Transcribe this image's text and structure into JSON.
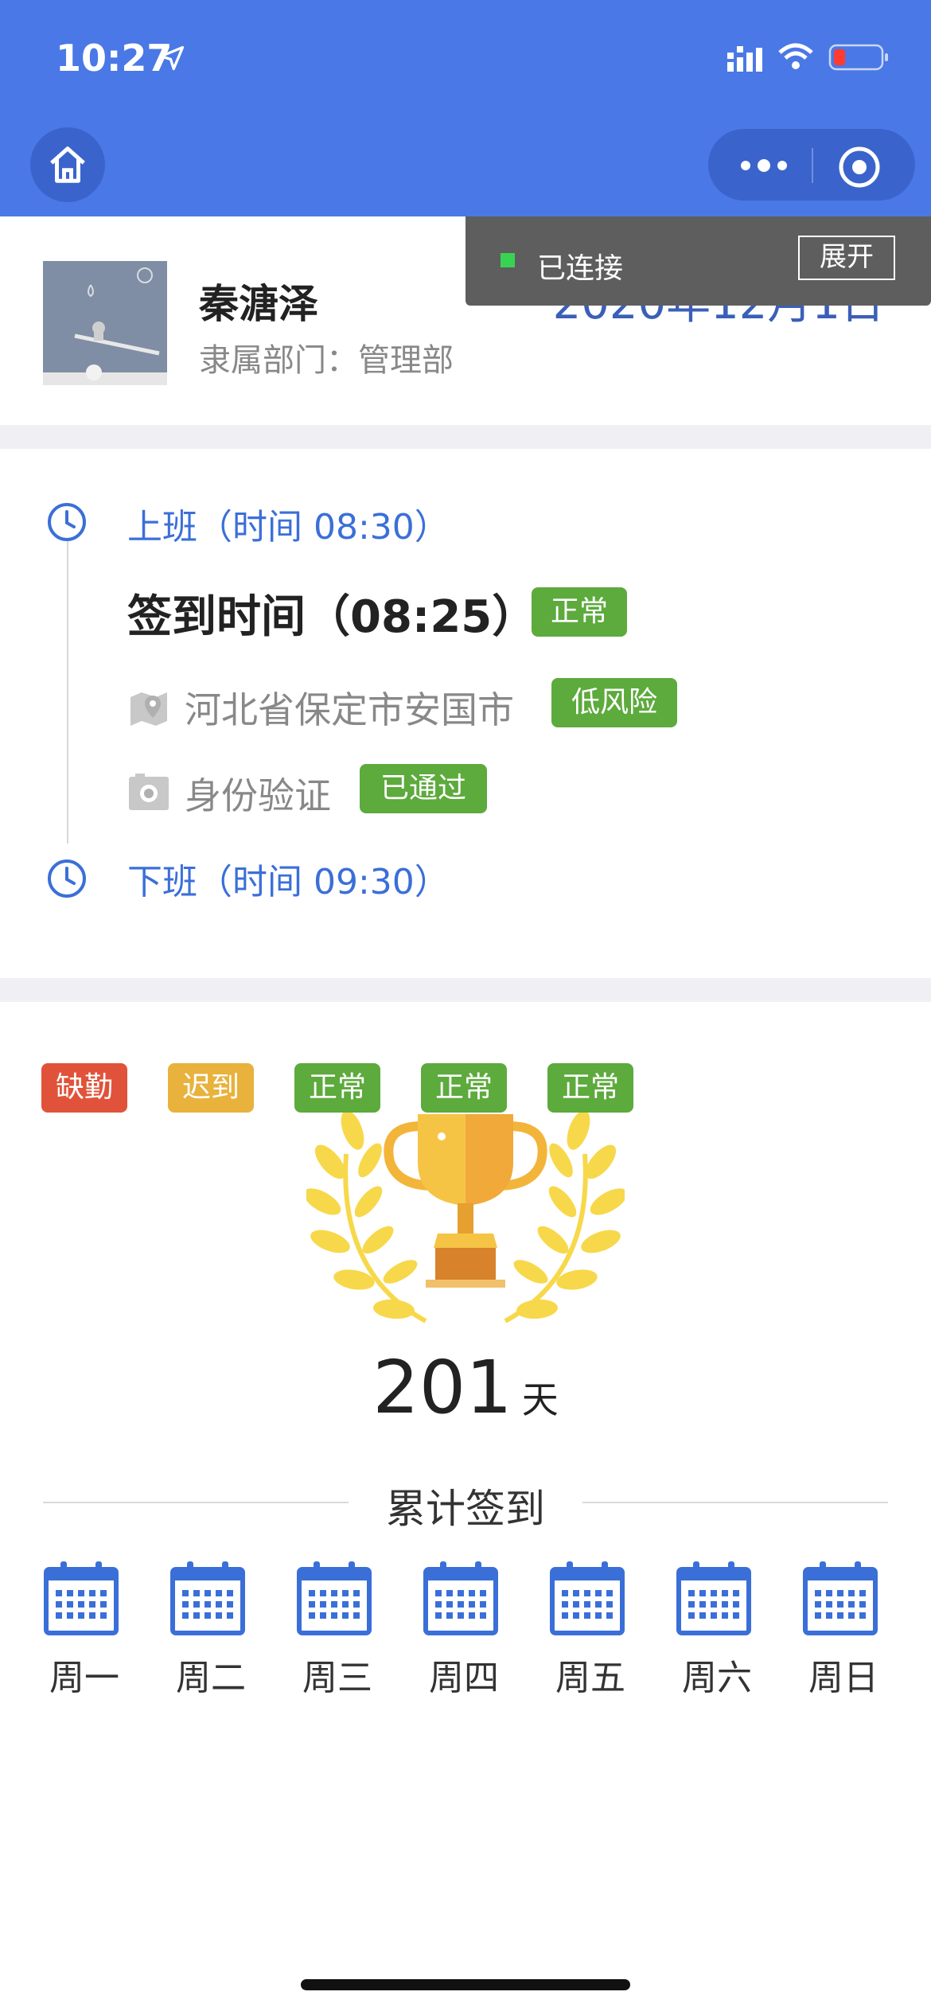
{
  "status_bar": {
    "time": "10:27"
  },
  "profile": {
    "name": "秦溏泽",
    "department": "隶属部门：管理部",
    "date": "2020年12月1日"
  },
  "connection": {
    "status": "已连接",
    "expand": "展开"
  },
  "timeline": {
    "on_duty": "上班（时间 08:30）",
    "sign_in": "签到时间（08:25）",
    "sign_in_status": "正常",
    "location": "河北省保定市安国市",
    "location_status": "低风险",
    "identity": "身份验证",
    "identity_status": "已通过",
    "off_duty": "下班（时间 09:30）"
  },
  "summary": {
    "count": "201",
    "unit": "天",
    "label": "累计签到"
  },
  "week": [
    {
      "day": "周一",
      "status": "缺勤",
      "color": "#e0533a"
    },
    {
      "day": "周二",
      "status": "迟到",
      "color": "#e8b23c"
    },
    {
      "day": "周三",
      "status": "正常",
      "color": "#5daa3d"
    },
    {
      "day": "周四",
      "status": "正常",
      "color": "#5daa3d"
    },
    {
      "day": "周五",
      "status": "正常",
      "color": "#5daa3d"
    },
    {
      "day": "周六",
      "status": "",
      "color": ""
    },
    {
      "day": "周日",
      "status": "",
      "color": ""
    }
  ],
  "colors": {
    "header": "#4a78e6",
    "accent": "#3b6fd8",
    "success": "#5daa3d"
  }
}
